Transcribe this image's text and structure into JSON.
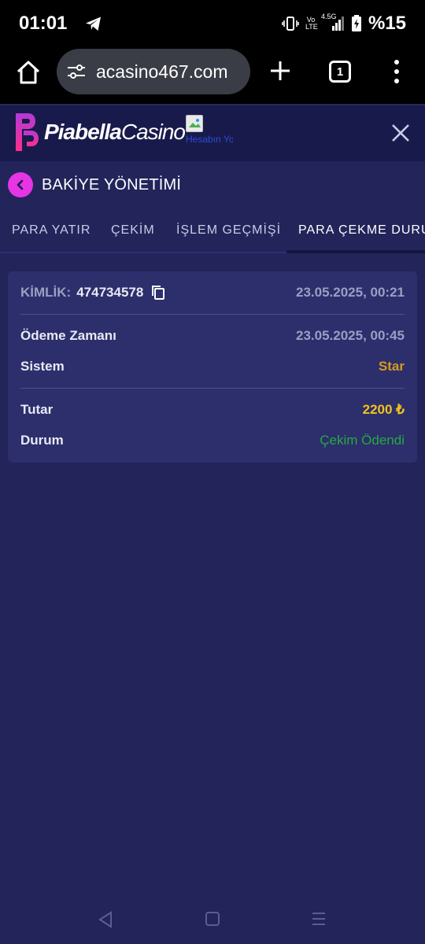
{
  "status_bar": {
    "time": "01:01",
    "battery": "%15",
    "network_label": "4.5G",
    "volte_label": "Vo LTE",
    "icons": [
      "telegram-icon",
      "vibrate-icon",
      "signal-icon",
      "battery-charging-icon"
    ]
  },
  "browser": {
    "url": "acasino467.com",
    "tab_count": "1"
  },
  "site": {
    "brand_bold": "Piabella",
    "brand_light": "Casino",
    "broken_image_alt": "Hesabın Yoks..."
  },
  "page": {
    "title": "BAKİYE YÖNETİMİ"
  },
  "tabs": [
    {
      "label": "PARA YATIR"
    },
    {
      "label": "ÇEKİM"
    },
    {
      "label": "İŞLEM GEÇMİŞİ"
    },
    {
      "label": "PARA ÇEKME DURUMU",
      "active": true
    }
  ],
  "transaction": {
    "id_label": "KİMLİK:",
    "id_value": "474734578",
    "created_at": "23.05.2025, 00:21",
    "payment_time_label": "Ödeme Zamanı",
    "payment_time_value": "23.05.2025, 00:45",
    "system_label": "Sistem",
    "system_value": "Star",
    "amount_label": "Tutar",
    "amount_value": "2200 ₺",
    "status_label": "Durum",
    "status_value": "Çekim Ödendi"
  },
  "colors": {
    "page_bg": "#22245a",
    "card_bg": "#2c2f6b",
    "accent_magenta": "#e535e5",
    "system_orange": "#d89a1c",
    "amount_yellow": "#f2c21b",
    "status_green": "#27a844"
  }
}
